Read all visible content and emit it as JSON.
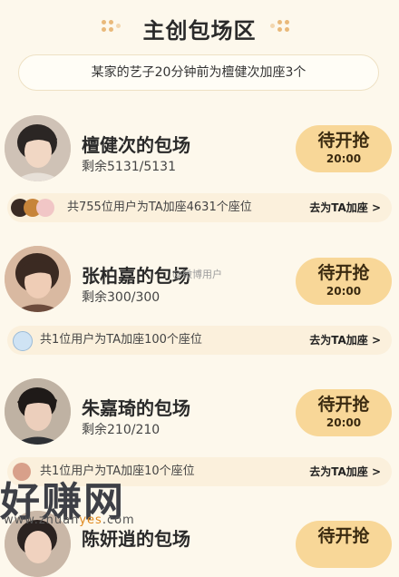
{
  "header": {
    "title": "主创包场区"
  },
  "notice": {
    "text": "某家的艺子20分钟前为檀健次加座3个"
  },
  "cards": [
    {
      "name": "檀健次的包场",
      "remain": "剩余5131/5131",
      "button": "待开抢",
      "time": "20:00",
      "supporters": "共755位用户为TA加座4631个座位",
      "action": "去为TA加座 >"
    },
    {
      "name": "张柏嘉的包场",
      "remain": "剩余300/300",
      "button": "待开抢",
      "time": "20:00",
      "supporters": "共1位用户为TA加座100个座位",
      "action": "去为TA加座 >"
    },
    {
      "name": "朱嘉琦的包场",
      "remain": "剩余210/210",
      "button": "待开抢",
      "time": "20:00",
      "supporters": "共1位用户为TA加座10个座位",
      "action": "去为TA加座 >"
    },
    {
      "name": "陈妍逍的包场",
      "button": "待开抢"
    }
  ],
  "overlay": {
    "weibo_mark": "@微博用户",
    "watermark": "好赚网",
    "watermark_url_a": "www.zhuan",
    "watermark_url_b": "yes",
    "watermark_url_c": ".com"
  },
  "colors": {
    "background": "#fdf8ec",
    "button": "#f8d798",
    "bar": "#fbf0dc",
    "accent_dots": "#e9b97a"
  }
}
